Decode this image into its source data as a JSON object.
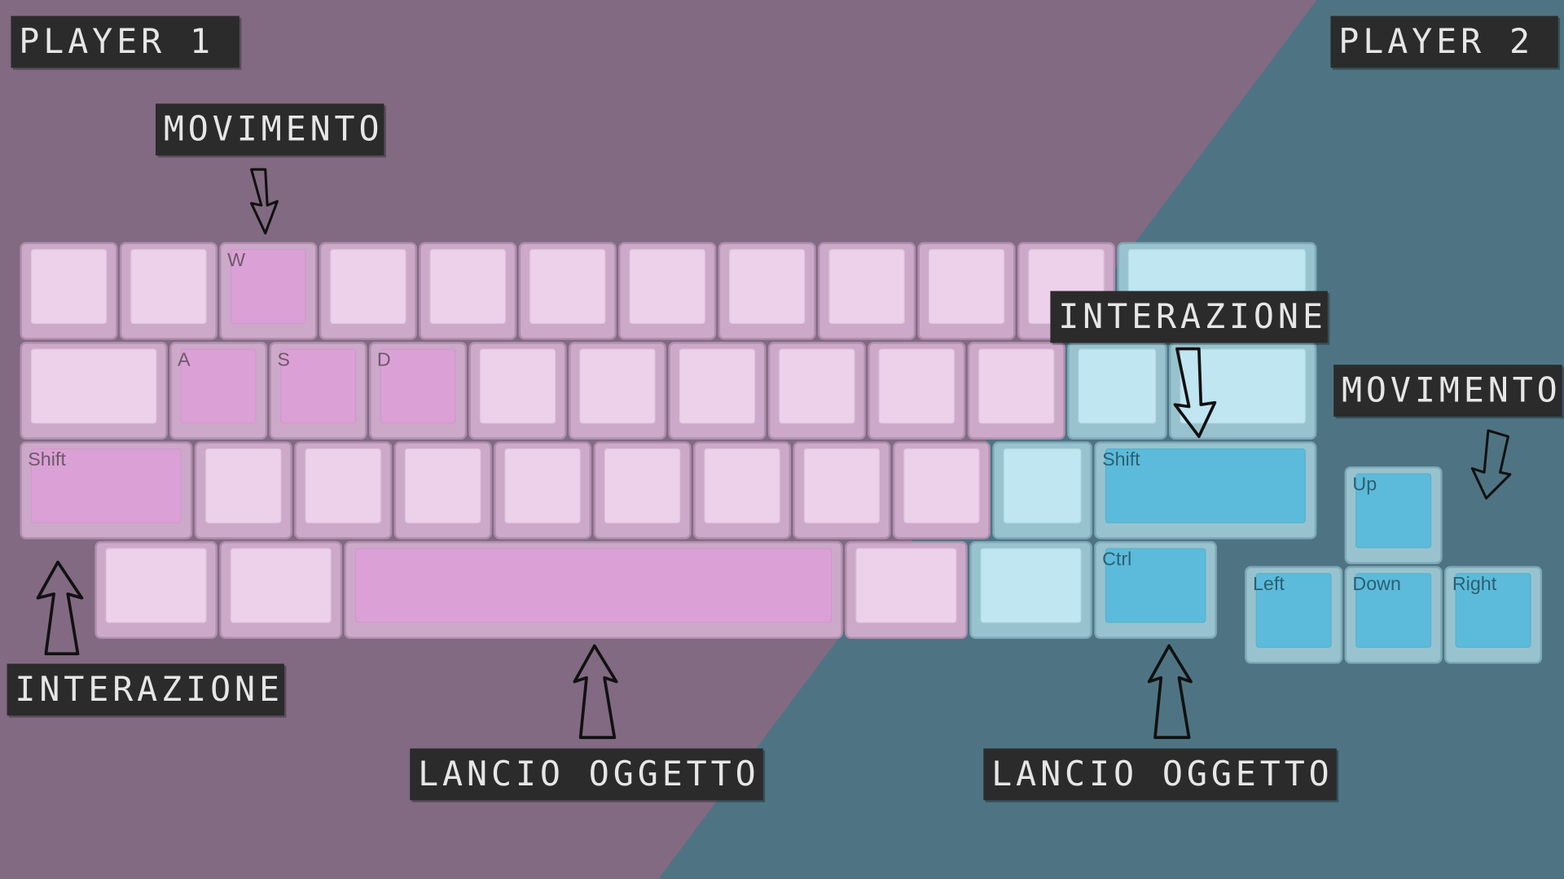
{
  "colors": {
    "player1_bg": "#826a82",
    "player2_bg": "#4e7483",
    "label_bg": "#2b2b2b",
    "p1_highlight": "#dba1d6",
    "p2_highlight": "#5cbbda"
  },
  "players": {
    "p1_title": "PLAYER 1",
    "p2_title": "PLAYER 2"
  },
  "labels": {
    "p1_move": "MOVIMENTO",
    "p1_interact": "INTERAZIONE",
    "p1_throw": "LANCIO OGGETTO",
    "p2_move": "MOVIMENTO",
    "p2_interact": "INTERAZIONE",
    "p2_throw": "LANCIO OGGETTO"
  },
  "keys": {
    "w": "W",
    "a": "A",
    "s": "S",
    "d": "D",
    "shift_left": "Shift",
    "shift_right": "Shift",
    "ctrl": "Ctrl",
    "up": "Up",
    "left": "Left",
    "down": "Down",
    "right": "Right"
  },
  "icons": {
    "arrow": "hand-drawn-arrow-icon"
  }
}
